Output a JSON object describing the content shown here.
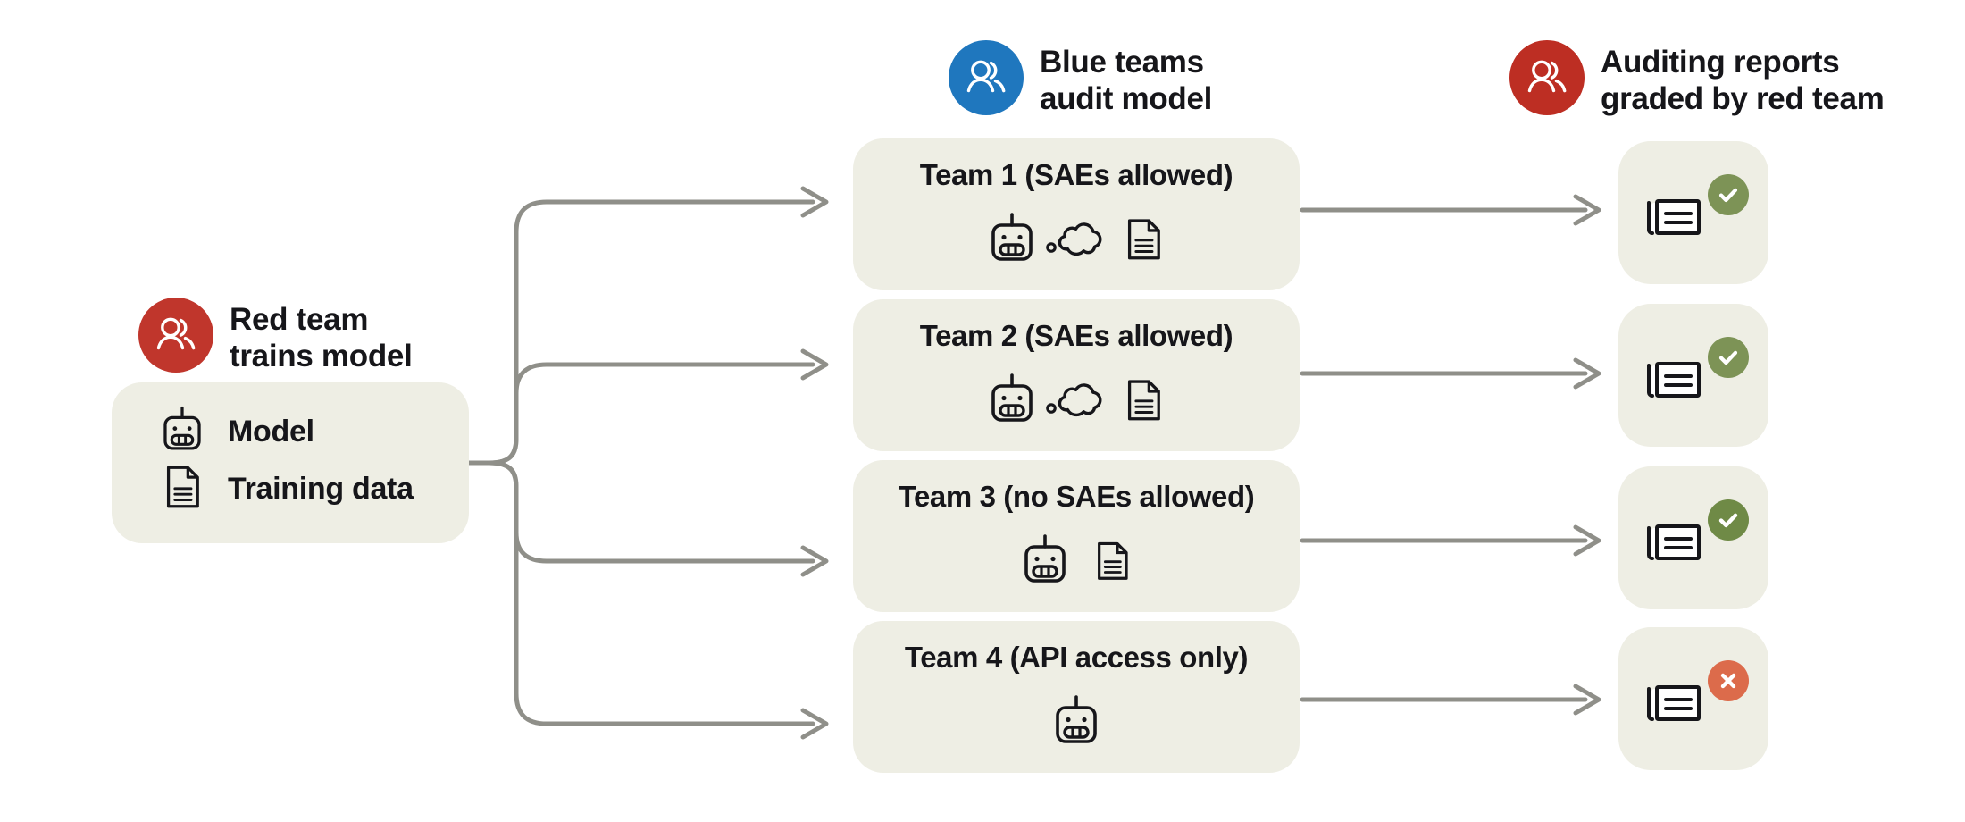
{
  "diagram": {
    "title": "Red team / blue team model auditing game",
    "background": "#ffffff",
    "panel_fill": "#eeeee4",
    "wire_color": "#8f8f89",
    "ink": "#16161a"
  },
  "headers": [
    {
      "id": "red-team-trains",
      "label": "Red team\ntrains model",
      "icon": "people-icon",
      "circle_color": "#c0362c"
    },
    {
      "id": "blue-teams-audit",
      "label": "Blue teams\naudit model",
      "icon": "people-icon",
      "circle_color": "#1f77be"
    },
    {
      "id": "auditing-reports-graded",
      "label": "Auditing reports\ngraded by red team",
      "icon": "people-icon",
      "circle_color": "#bd2e23"
    }
  ],
  "model_panel": {
    "rows": [
      {
        "icon": "robot-icon",
        "label": "Model"
      },
      {
        "icon": "document-icon",
        "label": "Training data"
      }
    ]
  },
  "teams": [
    {
      "id": "team-1",
      "title": "Team 1 (SAEs allowed)",
      "icons": [
        "robot-icon",
        "thought-bubble-icon",
        "document-icon"
      ]
    },
    {
      "id": "team-2",
      "title": "Team 2 (SAEs allowed)",
      "icons": [
        "robot-icon",
        "thought-bubble-icon",
        "document-icon"
      ]
    },
    {
      "id": "team-3",
      "title": "Team 3 (no SAEs allowed)",
      "icons": [
        "robot-icon",
        "document-icon"
      ]
    },
    {
      "id": "team-4",
      "title": "Team 4 (API access only)",
      "icons": [
        "robot-icon"
      ]
    }
  ],
  "reports": [
    {
      "id": "report-1",
      "icon": "news-report-icon",
      "status": "pass",
      "status_icon": "check-circle-icon",
      "status_color": "#7d9356"
    },
    {
      "id": "report-2",
      "icon": "news-report-icon",
      "status": "pass",
      "status_icon": "check-circle-icon",
      "status_color": "#7d9356"
    },
    {
      "id": "report-3",
      "icon": "news-report-icon",
      "status": "pass",
      "status_icon": "check-circle-icon",
      "status_color": "#6f8a46"
    },
    {
      "id": "report-4",
      "icon": "news-report-icon",
      "status": "fail",
      "status_icon": "x-circle-icon",
      "status_color": "#dc6b4b"
    }
  ]
}
